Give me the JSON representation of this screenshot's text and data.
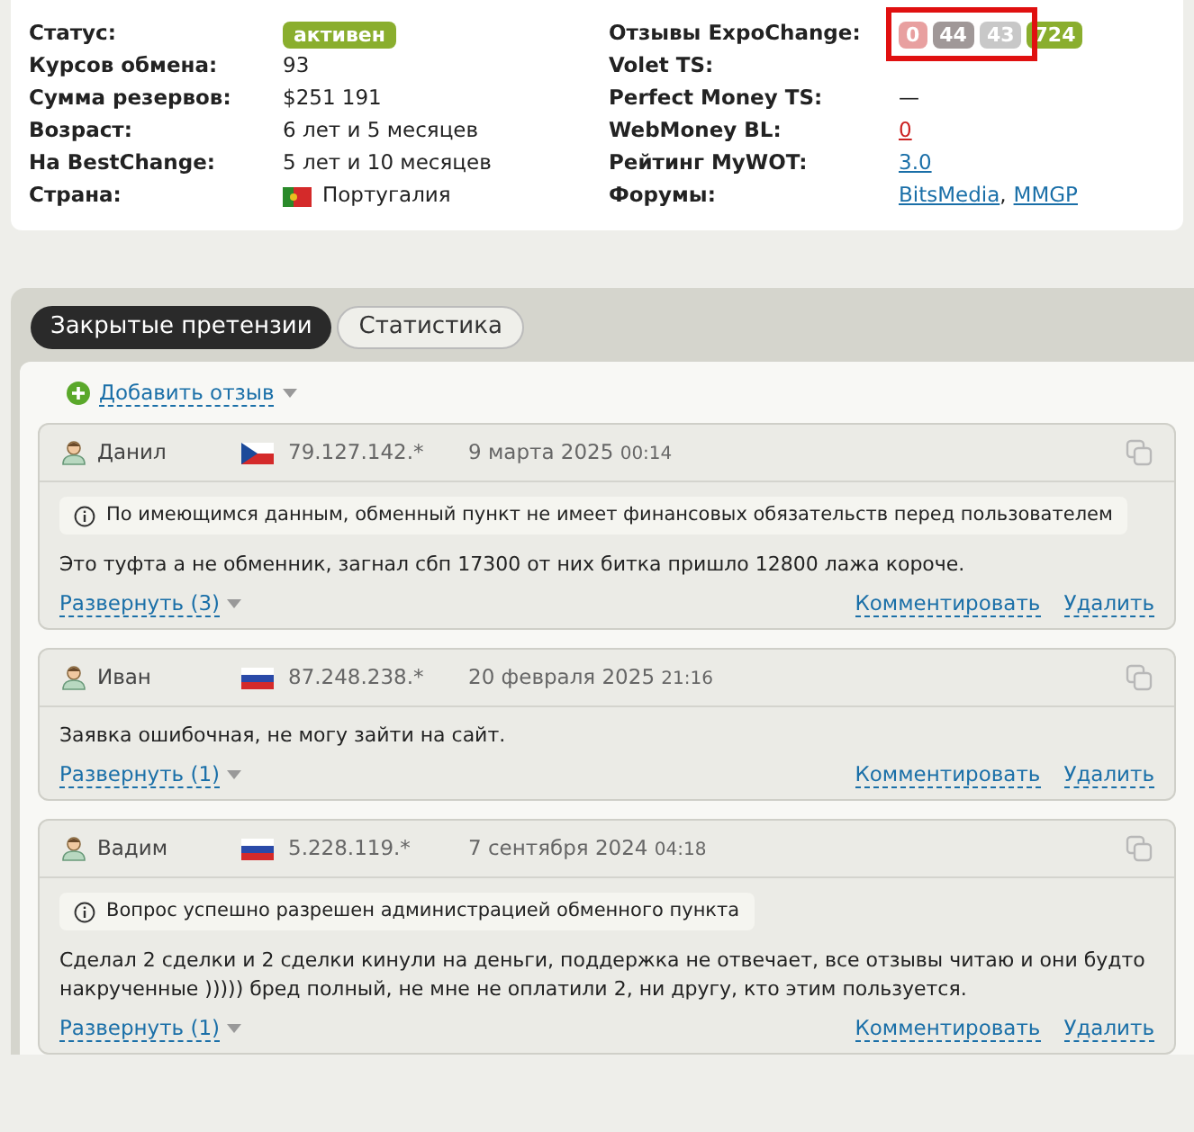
{
  "info_left": [
    {
      "label": "Статус:",
      "kind": "badge",
      "value": "активен"
    },
    {
      "label": "Курсов обмена:",
      "kind": "text",
      "value": "93"
    },
    {
      "label": "Сумма резервов:",
      "kind": "text",
      "value": "$251 191"
    },
    {
      "label": "Возраст:",
      "kind": "text",
      "value": "6 лет и 5 месяцев"
    },
    {
      "label": "На BestChange:",
      "kind": "text",
      "value": "5 лет и 10 месяцев"
    },
    {
      "label": "Страна:",
      "kind": "flag",
      "flag": {
        "kind": "pt"
      },
      "value": "Португалия"
    }
  ],
  "info_right": [
    {
      "label": "Отзывы ExpoChange:",
      "kind": "badges",
      "highlighted": true,
      "badges": [
        {
          "text": "0",
          "color": "#e8a0a0"
        },
        {
          "text": "44",
          "color": "#a09898"
        },
        {
          "text": "43",
          "color": "#c8c8c8"
        },
        {
          "text": "724",
          "color": "#8aae2e"
        }
      ]
    },
    {
      "label": "Volet TS:",
      "kind": "text"
    },
    {
      "label": "Perfect Money TS:",
      "kind": "text",
      "value": "—"
    },
    {
      "label": "WebMoney BL:",
      "kind": "links",
      "links": [
        {
          "text": "0",
          "color": "#cc2222"
        }
      ]
    },
    {
      "label": "Рейтинг MyWOT:",
      "kind": "links",
      "links": [
        {
          "text": "3.0",
          "color": "#1a6fa8"
        }
      ]
    },
    {
      "label": "Форумы:",
      "kind": "links",
      "separator": ",",
      "links": [
        {
          "text": "BitsMedia",
          "color": "#1a6fa8"
        },
        {
          "text": "MMGP",
          "color": "#1a6fa8"
        }
      ]
    }
  ],
  "tabs": [
    {
      "label": "Закрытые претензии",
      "selected": true
    },
    {
      "label": "Статистика",
      "selected": false
    }
  ],
  "add_review": "Добавить отзыв",
  "reviews": [
    {
      "name": "Данил",
      "flag": {
        "kind": "cz"
      },
      "ip": "79.127.142.*",
      "date": "9 марта 2025",
      "time": "00:14",
      "notice": "По имеющимся данным, обменный пункт не имеет финансовых обязательств перед пользователем",
      "text": "Это туфта а не обменник, загнал сбп 17300 от них битка пришло 12800 лажа короче.",
      "expand": "Развернуть (3)",
      "comment": "Комментировать",
      "delete": "Удалить"
    },
    {
      "name": "Иван",
      "flag": {
        "kind": "ru"
      },
      "ip": "87.248.238.*",
      "date": "20 февраля 2025",
      "time": "21:16",
      "text": "Заявка ошибочная, не могу зайти на сайт.",
      "expand": "Развернуть (1)",
      "comment": "Комментировать",
      "delete": "Удалить"
    },
    {
      "name": "Вадим",
      "flag": {
        "kind": "ru"
      },
      "ip": "5.228.119.*",
      "date": "7 сентября 2024",
      "time": "04:18",
      "notice": "Вопрос успешно разрешен администрацией обменного пункта",
      "text": "Сделал 2 сделки и 2 сделки кинули на деньги, поддержка не отвечает, все отзывы читаю и они будто накрученные ))))) бред полный, не мне не оплатили 2, ни другу, кто этим пользуется.",
      "expand": "Развернуть (1)",
      "comment": "Комментировать",
      "delete": "Удалить"
    }
  ]
}
